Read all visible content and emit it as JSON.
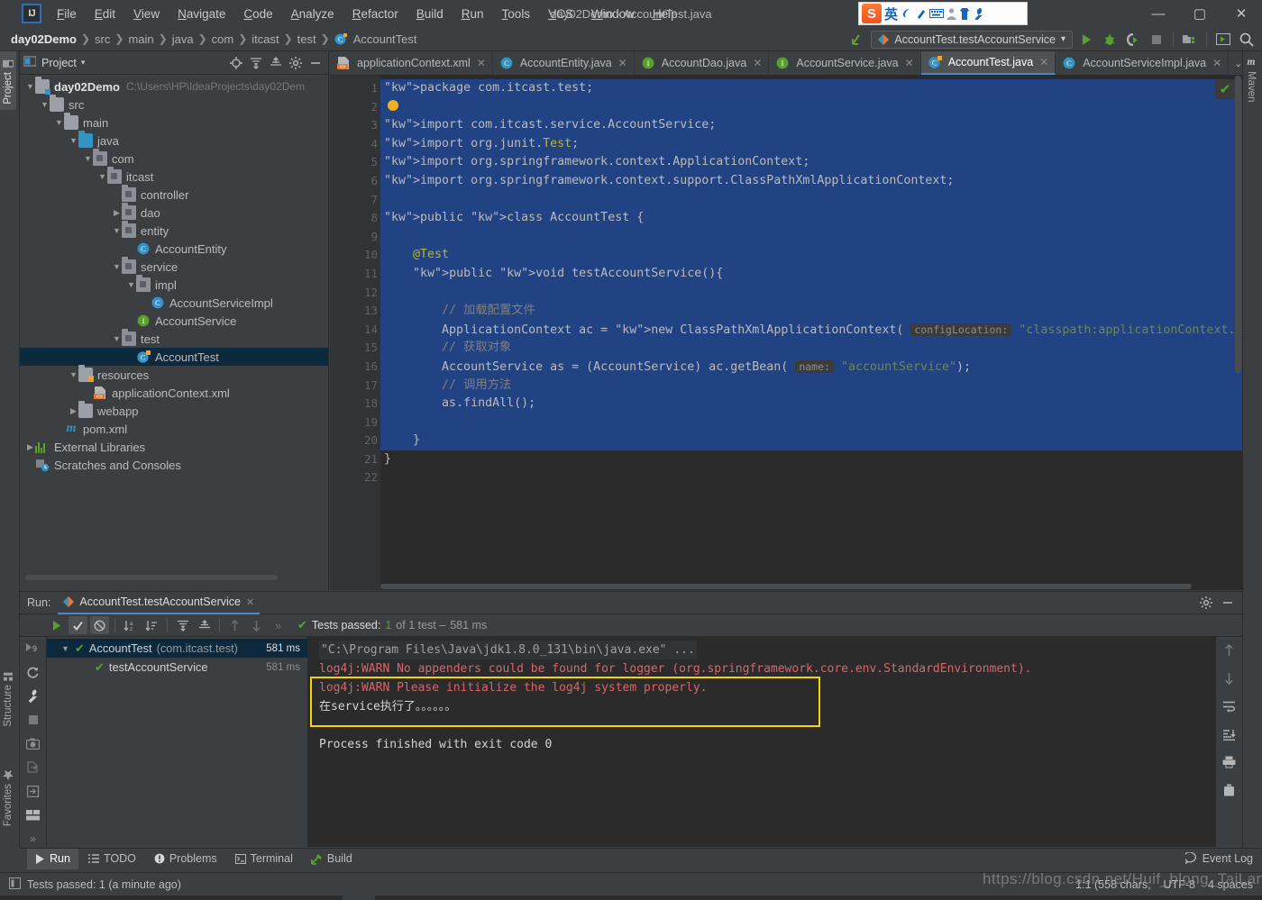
{
  "window": {
    "title": "day02Demo - AccountTest.java",
    "minimize": "—",
    "maximize": "▢",
    "close": "✕"
  },
  "menu": {
    "items": [
      "File",
      "Edit",
      "View",
      "Navigate",
      "Code",
      "Analyze",
      "Refactor",
      "Build",
      "Run",
      "Tools",
      "VCS",
      "Window",
      "Help"
    ]
  },
  "ime": {
    "logo": "S",
    "mode": "英",
    "items": [
      "☽",
      "✎",
      "⌨",
      "☻",
      "♟",
      "🔧"
    ]
  },
  "breadcrumb": {
    "items": [
      "day02Demo",
      "src",
      "main",
      "java",
      "com",
      "itcast",
      "test",
      "AccountTest"
    ],
    "separator": "❯"
  },
  "nav_toolbar": {
    "run_config": "AccountTest.testAccountService",
    "dropdown_arrow": "▾",
    "buttons": [
      "run-button",
      "debug-button",
      "run-coverage-button",
      "stop-button",
      "project-structure-button",
      "select-run-button",
      "search-everywhere-button"
    ]
  },
  "left_strip": {
    "tabs": [
      "Project",
      "Structure",
      "Favorites"
    ]
  },
  "right_strip": {
    "tabs": [
      "Maven"
    ]
  },
  "project_panel": {
    "title": "Project",
    "dropdown": "▾",
    "actions": [
      "locate-icon",
      "expand-all-icon",
      "collapse-all-icon",
      "gear-icon",
      "hide-icon"
    ],
    "tree": [
      {
        "depth": 0,
        "arrow": "v",
        "icon": "folder-src",
        "label": "day02Demo",
        "bold": true,
        "path": "C:\\Users\\HP\\IdeaProjects\\day02Dem"
      },
      {
        "depth": 1,
        "arrow": "v",
        "icon": "folder",
        "label": "src"
      },
      {
        "depth": 2,
        "arrow": "v",
        "icon": "folder",
        "label": "main"
      },
      {
        "depth": 3,
        "arrow": "v",
        "icon": "folder-blue",
        "label": "java"
      },
      {
        "depth": 4,
        "arrow": "v",
        "icon": "package",
        "label": "com"
      },
      {
        "depth": 5,
        "arrow": "v",
        "icon": "package",
        "label": "itcast"
      },
      {
        "depth": 6,
        "arrow": "",
        "icon": "package",
        "label": "controller"
      },
      {
        "depth": 6,
        "arrow": ">",
        "icon": "package",
        "label": "dao"
      },
      {
        "depth": 6,
        "arrow": "v",
        "icon": "package",
        "label": "entity"
      },
      {
        "depth": 7,
        "arrow": "",
        "icon": "class",
        "label": "AccountEntity"
      },
      {
        "depth": 6,
        "arrow": "v",
        "icon": "package",
        "label": "service"
      },
      {
        "depth": 7,
        "arrow": "v",
        "icon": "package",
        "label": "impl"
      },
      {
        "depth": 8,
        "arrow": "",
        "icon": "class",
        "label": "AccountServiceImpl"
      },
      {
        "depth": 7,
        "arrow": "",
        "icon": "interface",
        "label": "AccountService"
      },
      {
        "depth": 6,
        "arrow": "v",
        "icon": "package",
        "label": "test"
      },
      {
        "depth": 7,
        "arrow": "",
        "icon": "test-class",
        "label": "AccountTest",
        "selected": true
      },
      {
        "depth": 3,
        "arrow": "v",
        "icon": "folder-res",
        "label": "resources"
      },
      {
        "depth": 4,
        "arrow": "",
        "icon": "xml",
        "label": "applicationContext.xml"
      },
      {
        "depth": 3,
        "arrow": ">",
        "icon": "folder",
        "label": "webapp"
      },
      {
        "depth": 2,
        "arrow": "",
        "icon": "maven",
        "label": "pom.xml"
      },
      {
        "depth": 0,
        "arrow": ">",
        "icon": "library",
        "label": "External Libraries"
      },
      {
        "depth": 0,
        "arrow": "",
        "icon": "scratch",
        "label": "Scratches and Consoles"
      }
    ]
  },
  "editor": {
    "tabs": [
      {
        "label": "applicationContext.xml",
        "icon": "xml",
        "active": false
      },
      {
        "label": "AccountEntity.java",
        "icon": "class",
        "active": false
      },
      {
        "label": "AccountDao.java",
        "icon": "interface",
        "active": false
      },
      {
        "label": "AccountService.java",
        "icon": "interface",
        "active": false
      },
      {
        "label": "AccountTest.java",
        "icon": "test-class",
        "active": true
      },
      {
        "label": "AccountServiceImpl.java",
        "icon": "class",
        "active": false
      }
    ],
    "tab_close": "✕",
    "tabs_overflow": "⌄",
    "line_numbers": [
      "1",
      "2",
      "3",
      "4",
      "5",
      "6",
      "7",
      "8",
      "9",
      "10",
      "11",
      "12",
      "13",
      "14",
      "15",
      "16",
      "17",
      "18",
      "19",
      "20",
      "21",
      "22"
    ],
    "code_lines": [
      {
        "n": 1,
        "text": "package com.itcast.test;",
        "selected": true
      },
      {
        "n": 2,
        "text": "",
        "selected": true
      },
      {
        "n": 3,
        "text": "import com.itcast.service.AccountService;",
        "selected": true
      },
      {
        "n": 4,
        "text": "import org.junit.Test;",
        "selected": true
      },
      {
        "n": 5,
        "text": "import org.springframework.context.ApplicationContext;",
        "selected": true
      },
      {
        "n": 6,
        "text": "import org.springframework.context.support.ClassPathXmlApplicationContext;",
        "selected": true
      },
      {
        "n": 7,
        "text": "",
        "selected": true
      },
      {
        "n": 8,
        "text": "public class AccountTest {",
        "selected": true
      },
      {
        "n": 9,
        "text": "",
        "selected": true
      },
      {
        "n": 10,
        "text": "    @Test",
        "selected": true
      },
      {
        "n": 11,
        "text": "    public void testAccountService(){",
        "selected": true
      },
      {
        "n": 12,
        "text": "",
        "selected": true
      },
      {
        "n": 13,
        "text": "        // 加载配置文件",
        "selected": true
      },
      {
        "n": 14,
        "text": "        ApplicationContext ac = new ClassPathXmlApplicationContext( configLocation: \"classpath:applicationContext.xml\");",
        "selected": true
      },
      {
        "n": 15,
        "text": "        // 获取对象",
        "selected": true
      },
      {
        "n": 16,
        "text": "        AccountService as = (AccountService) ac.getBean( name: \"accountService\");",
        "selected": true
      },
      {
        "n": 17,
        "text": "        // 调用方法",
        "selected": true
      },
      {
        "n": 18,
        "text": "        as.findAll();",
        "selected": true
      },
      {
        "n": 19,
        "text": "",
        "selected": true
      },
      {
        "n": 20,
        "text": "    }",
        "selected": true
      },
      {
        "n": 21,
        "text": "}",
        "selected": false
      },
      {
        "n": 22,
        "text": "",
        "selected": false
      }
    ],
    "param_hints": {
      "config_location": "configLocation:",
      "name": "name:"
    },
    "inspection_status": "✔"
  },
  "run_panel": {
    "label": "Run:",
    "tab_title": "AccountTest.testAccountService",
    "tab_close": "✕",
    "header_actions": [
      "gear-icon",
      "hide-icon"
    ],
    "toolbar": [
      "rerun-icon",
      "show-passed-icon",
      "hide-ignored-icon",
      "sort-alpha-icon",
      "sort-duration-icon",
      "expand-all-icon",
      "collapse-all-icon",
      "prev-failed-icon",
      "next-failed-icon",
      "more-icon"
    ],
    "status": {
      "check": "✔",
      "passed_label": "Tests passed:",
      "passed_count": "1",
      "of_text": "of 1 test –",
      "duration": "581 ms"
    },
    "tests": [
      {
        "indent": 0,
        "arrow": "v",
        "check": "✔",
        "name": "AccountTest",
        "pkg": "(com.itcast.test)",
        "ms": "581 ms",
        "selected": true
      },
      {
        "indent": 1,
        "arrow": "",
        "check": "✔",
        "name": "testAccountService",
        "pkg": "",
        "ms": "581 ms",
        "selected": false
      }
    ],
    "console": [
      {
        "kind": "cmd",
        "text": "\"C:\\Program Files\\Java\\jdk1.8.0_131\\bin\\java.exe\" ..."
      },
      {
        "kind": "err",
        "text": "log4j:WARN No appenders could be found for logger (org.springframework.core.env.StandardEnvironment)."
      },
      {
        "kind": "err",
        "text": "log4j:WARN Please initialize the log4j system properly."
      },
      {
        "kind": "out",
        "text": "在service执行了。。。。。。"
      },
      {
        "kind": "blank",
        "text": ""
      },
      {
        "kind": "out",
        "text": "Process finished with exit code 0"
      }
    ],
    "highlight_color": "#f5d40a",
    "left_gutter": [
      "rerun-failed-icon",
      "restart-icon",
      "settings-wrench-icon",
      "stop-icon",
      "screenshot-icon",
      "export-icon",
      "import-icon",
      "layout-icon",
      "more-icon"
    ],
    "right_gutter": [
      "scroll-up-icon",
      "scroll-down-icon",
      "soft-wrap-icon",
      "scroll-to-end-icon",
      "print-icon",
      "clear-all-icon"
    ]
  },
  "bottom_tabs": {
    "items": [
      {
        "label": "Run",
        "icon": "run-icon",
        "active": true
      },
      {
        "label": "TODO",
        "icon": "todo-icon",
        "active": false
      },
      {
        "label": "Problems",
        "icon": "problems-icon",
        "active": false
      },
      {
        "label": "Terminal",
        "icon": "terminal-icon",
        "active": false
      },
      {
        "label": "Build",
        "icon": "build-icon",
        "active": false
      }
    ],
    "event_log": "Event Log"
  },
  "statusbar": {
    "message": "Tests passed: 1 (a minute ago)",
    "caret": "1:1 (558 chars,",
    "encoding": "UTF-8",
    "indent": "4 spaces",
    "watermark": "https://blog.csdn.net/Huif_blong_TaiLang"
  },
  "colors": {
    "accent": "#4a88c7",
    "selection": "#214283",
    "error": "#d9656a",
    "success": "#5aa02c",
    "highlight": "#f5d40a",
    "panel": "#3c3f41",
    "editor_bg": "#2b2b2b"
  }
}
